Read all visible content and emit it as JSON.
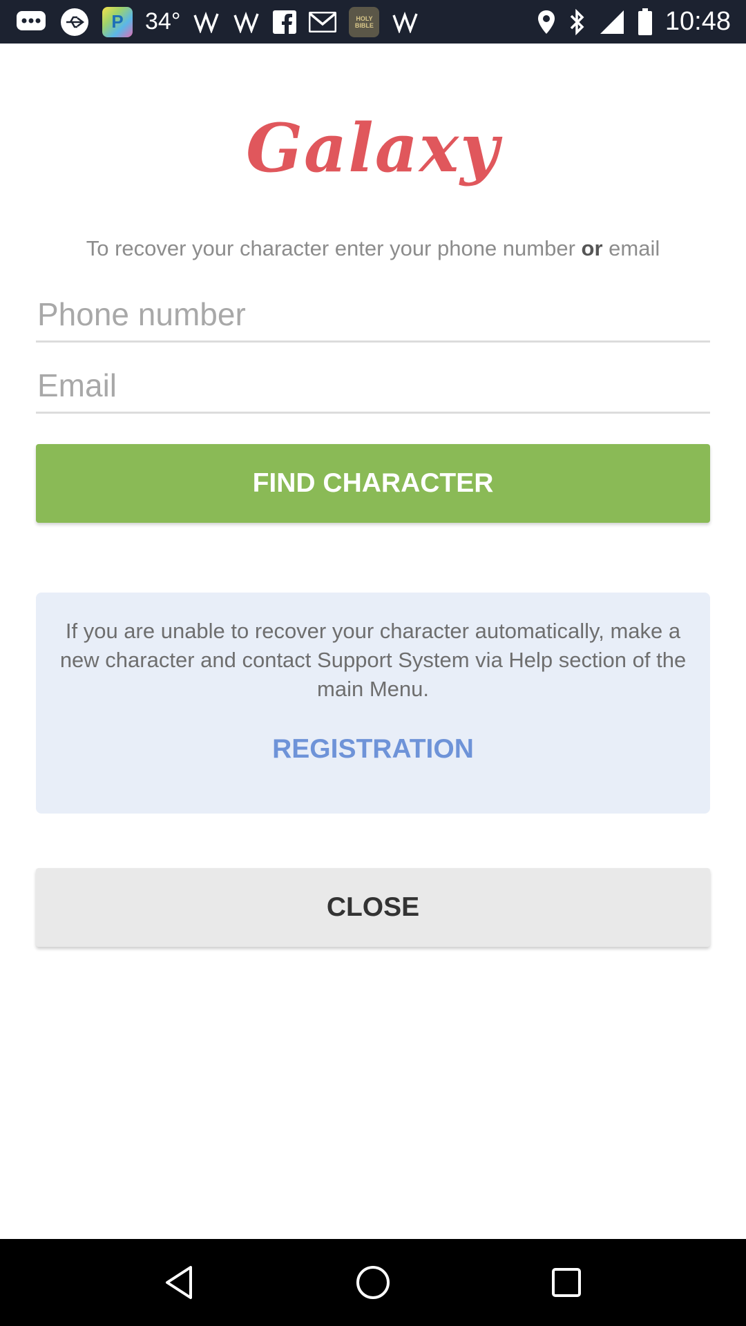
{
  "status_bar": {
    "temperature": "34°",
    "time": "10:48",
    "icons": [
      "chat-icon",
      "usb-icon",
      "pandora-app-icon",
      "temperature-text",
      "signal-w-icon",
      "signal-w-icon",
      "facebook-icon",
      "gmail-icon",
      "holy-bible-app-icon",
      "signal-w-icon",
      "location-icon",
      "bluetooth-icon",
      "cellular-signal-icon",
      "battery-icon"
    ],
    "pandora_letter": "P",
    "bible_text": "HOLY BIBLE"
  },
  "app": {
    "logo_text": "Galaxy",
    "instruction_pre": "To recover your character enter your phone number",
    "instruction_bold": "or",
    "instruction_post": "email",
    "phone_placeholder": "Phone number",
    "phone_value": "",
    "email_placeholder": "Email",
    "email_value": "",
    "find_button_label": "FIND CHARACTER",
    "info_text": "If you are unable to recover your character automatically, make a new character and contact Support System via Help section of the main Menu.",
    "registration_label": "REGISTRATION",
    "close_button_label": "CLOSE"
  },
  "colors": {
    "logo": "#e0575c",
    "find_button": "#8aba56",
    "info_box": "#e8eef8",
    "registration_link": "#6e93d8",
    "close_button": "#e9e9e9",
    "status_bar": "#1c2230"
  },
  "nav_bar": {
    "buttons": [
      "back-icon",
      "home-icon",
      "recents-icon"
    ]
  }
}
